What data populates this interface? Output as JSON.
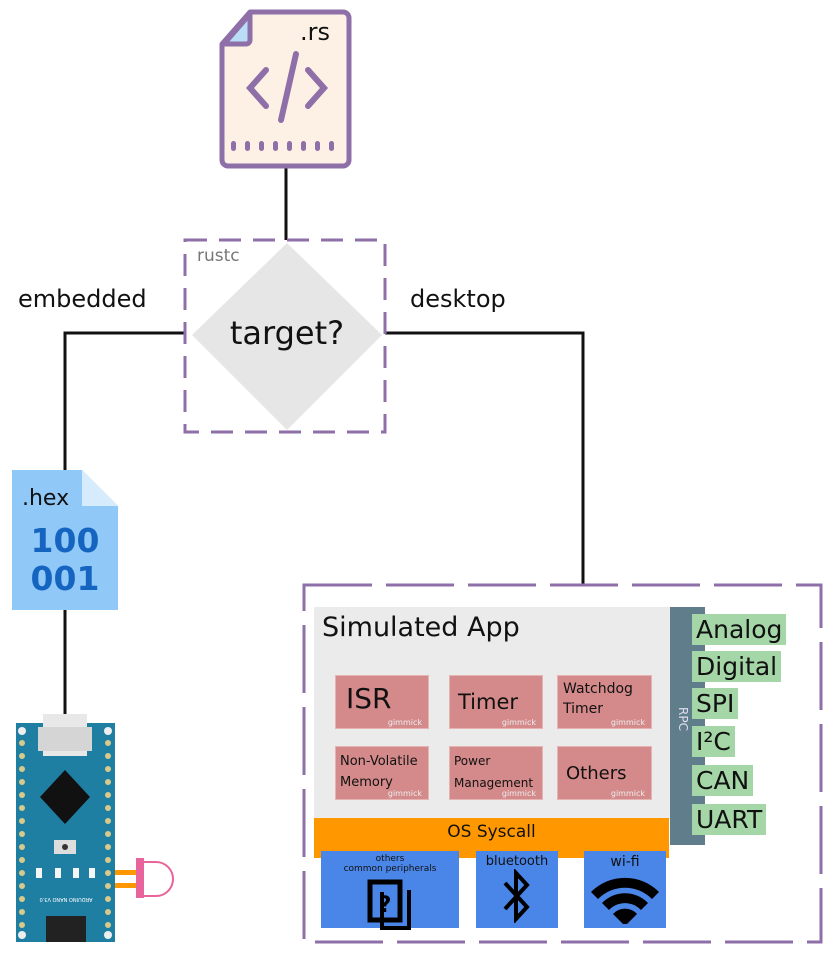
{
  "source_file": {
    "ext": ".rs"
  },
  "compiler": {
    "label": "rustc",
    "decision": "target?"
  },
  "branches": {
    "left": "embedded",
    "right": "desktop"
  },
  "hex_file": {
    "ext": ".hex",
    "line1": "100",
    "line2": "001"
  },
  "board": {
    "name": "ARDUINO NANO V3.0"
  },
  "sim": {
    "title": "Simulated App",
    "modules": [
      {
        "label": "ISR",
        "tag": "gimmick"
      },
      {
        "label": "Timer",
        "tag": "gimmick"
      },
      {
        "label": "Watchdog Timer",
        "tag": "gimmick"
      },
      {
        "label": "Non-Volatile Memory",
        "tag": "gimmick"
      },
      {
        "label": "Power Management",
        "tag": "gimmick"
      },
      {
        "label": "Others",
        "tag": "gimmick"
      }
    ],
    "rpc": "RPC",
    "interfaces": [
      "Analog",
      "Digital",
      "SPI",
      "I²C",
      "CAN",
      "UART"
    ],
    "syscall": "OS Syscall",
    "peripherals": [
      {
        "label": "others\ncommon peripherals",
        "icon": "unknown-device-icon"
      },
      {
        "label": "bluetooth",
        "icon": "bluetooth-icon"
      },
      {
        "label": "wi-fi",
        "icon": "wifi-icon"
      }
    ]
  },
  "colors": {
    "purple": "#8e6fa8",
    "module": "#d48a8a",
    "syscall": "#ff9800",
    "rpc": "#607d8b",
    "interface": "#a5d6a7",
    "peripheral": "#4a86e8",
    "hex": "#90c8f8"
  }
}
